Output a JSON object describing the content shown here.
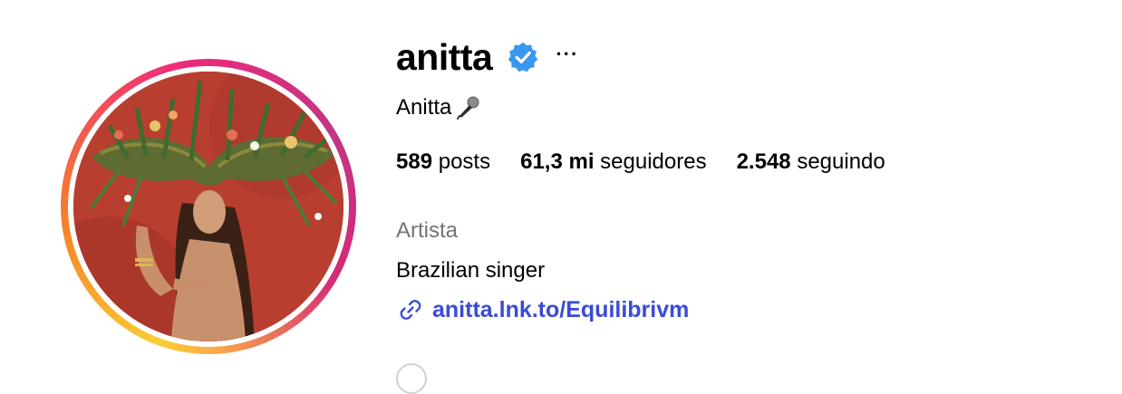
{
  "profile": {
    "username": "anitta",
    "full_name": "Anitta",
    "category": "Artista",
    "bio": "Brazilian singer",
    "link": "anitta.lnk.to/Equilibrivm",
    "more_label": "···"
  },
  "stats": {
    "posts_count": "589",
    "posts_label": "posts",
    "followers_count": "61,3 mi",
    "followers_label": "seguidores",
    "following_count": "2.548",
    "following_label": "seguindo"
  },
  "icons": {
    "verified": "verified-badge-icon",
    "name_emoji": "microphone-icon",
    "link": "link-icon"
  },
  "colors": {
    "verified_blue": "#3897f0",
    "link_blue": "#3a4bd6",
    "muted_text": "#737373",
    "avatar_background": "#b03a2e"
  }
}
